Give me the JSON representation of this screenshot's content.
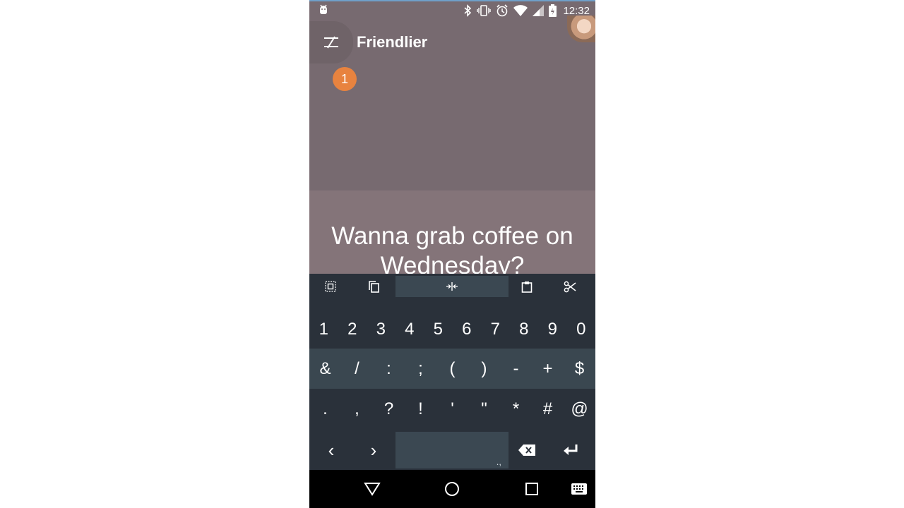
{
  "status_bar": {
    "time": "12:32",
    "icons": [
      "android-debug-icon",
      "bluetooth-icon",
      "vibrate-icon",
      "alarm-icon",
      "wifi-icon",
      "signal-icon",
      "battery-charging-icon"
    ]
  },
  "app": {
    "title": "Friendlier",
    "notification_count": "1"
  },
  "message": {
    "line1": "Wanna grab coffee on",
    "line2": "Wednesday?"
  },
  "keyboard": {
    "toolbar": [
      "select-all-icon",
      "copy-icon",
      "select-handle-icon",
      "paste-icon",
      "cut-icon"
    ],
    "row1": [
      "1",
      "2",
      "3",
      "4",
      "5",
      "6",
      "7",
      "8",
      "9",
      "0"
    ],
    "row2": [
      "&",
      "/",
      ":",
      ";",
      "(",
      ")",
      "-",
      "+",
      "$"
    ],
    "row3": [
      ".",
      ",",
      "?",
      "!",
      "'",
      "\"",
      "*",
      "#",
      "@"
    ],
    "row4": {
      "left": "‹",
      "right": "›",
      "space_hint": ".,"
    }
  },
  "colors": {
    "app_bg": "#776a70",
    "badge": "#e8833f",
    "keyboard_bg": "#2a313a",
    "keyboard_row": "#3a4750"
  }
}
